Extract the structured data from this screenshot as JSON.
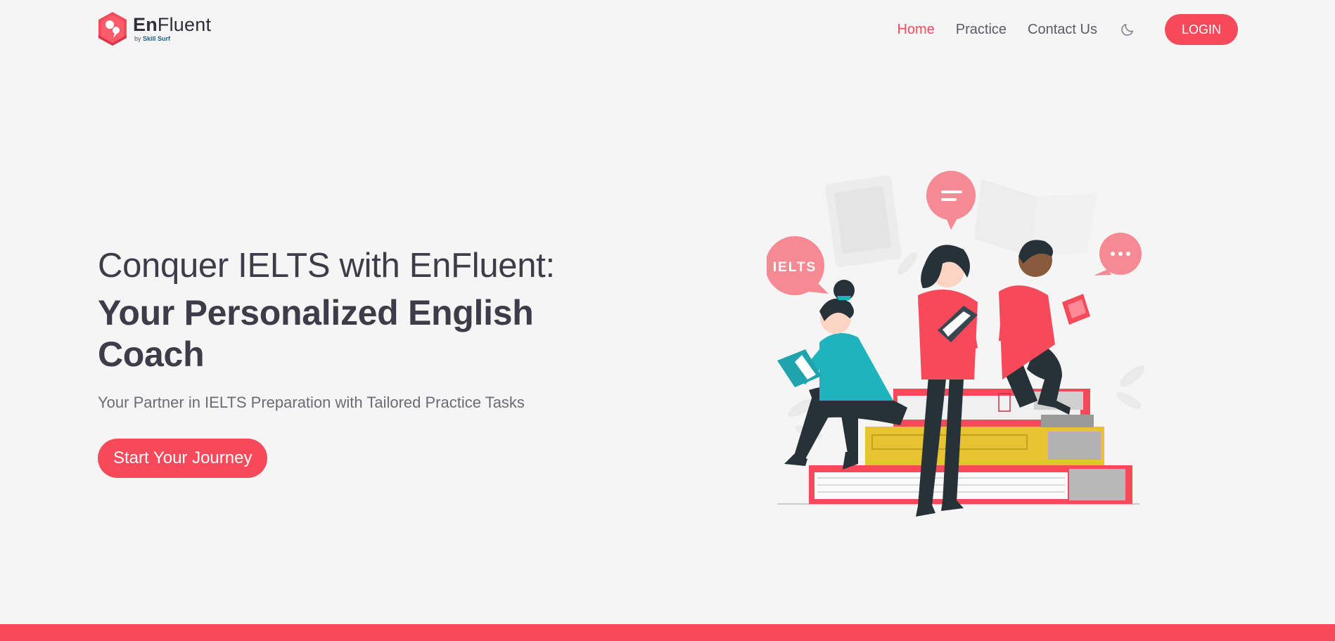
{
  "brand": {
    "name_bold": "En",
    "name_rest": "Fluent",
    "sub_prefix": "by",
    "sub_brand": "Skill Surf",
    "accent": "#f64a5b"
  },
  "nav": {
    "items": [
      {
        "label": "Home",
        "active": true
      },
      {
        "label": "Practice",
        "active": false
      },
      {
        "label": "Contact Us",
        "active": false
      }
    ],
    "theme_icon": "moon-icon",
    "login_label": "LOGIN"
  },
  "hero": {
    "line1": "Conquer IELTS with EnFluent:",
    "line2": "Your Personalized English Coach",
    "subtitle": "Your Partner in IELTS Preparation with Tailored Practice Tasks",
    "cta_label": "Start Your Journey",
    "bubble_text": "IELTS"
  }
}
